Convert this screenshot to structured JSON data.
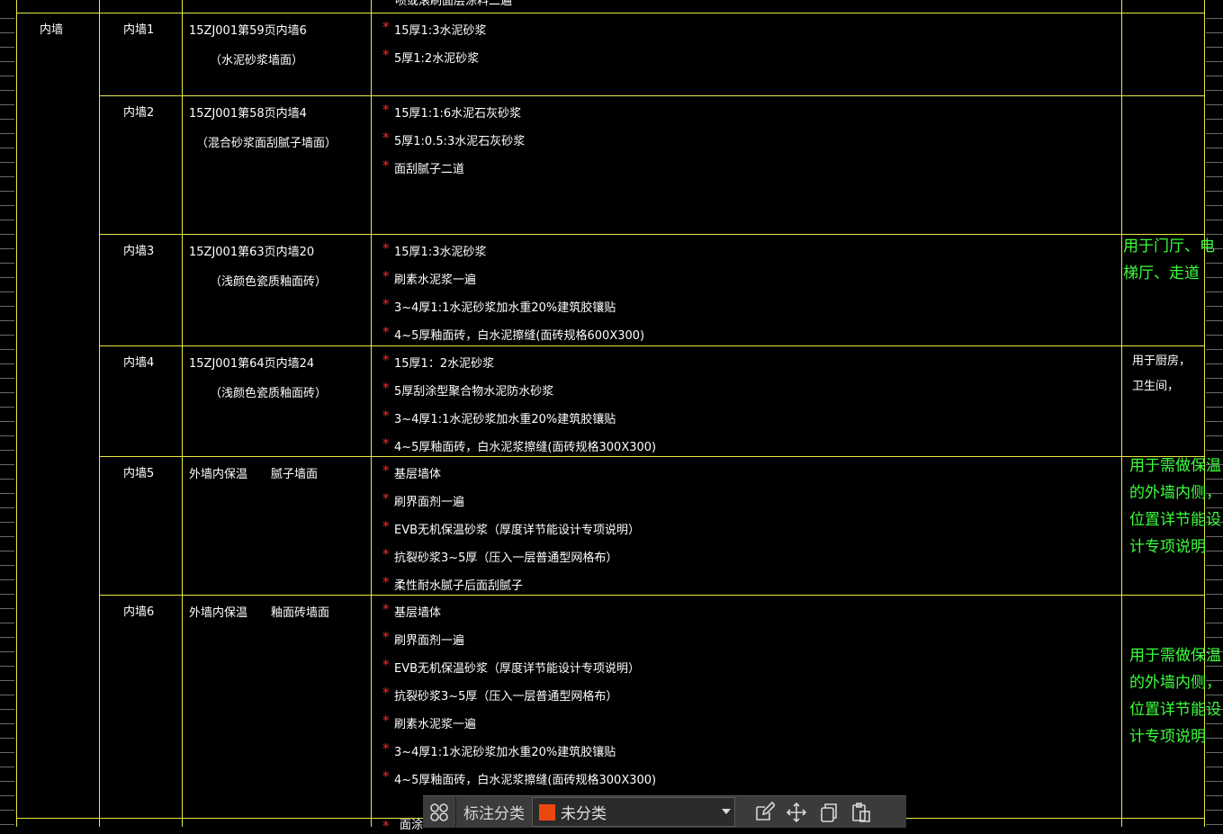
{
  "table": {
    "top_cutoff_text": "喷或滚刷面层涂料二遍",
    "group_label": "内墙",
    "rows": [
      {
        "name": "内墙1",
        "ref": "15ZJ001第59页内墙6",
        "ref_sub": "（水泥砂浆墙面）",
        "layers": [
          "15厚1:3水泥砂浆",
          "5厚1:2水泥砂浆"
        ],
        "note": ""
      },
      {
        "name": "内墙2",
        "ref": "15ZJ001第58页内墙4",
        "ref_sub": "（混合砂浆面刮腻子墙面）",
        "layers": [
          "15厚1:1:6水泥石灰砂浆",
          "5厚1:0.5:3水泥石灰砂浆",
          "面刮腻子二道"
        ],
        "note": ""
      },
      {
        "name": "内墙3",
        "ref": "15ZJ001第63页内墙20",
        "ref_sub": "（浅颜色瓷质釉面砖）",
        "layers": [
          "15厚1:3水泥砂浆",
          "刷素水泥浆一遍",
          "3~4厚1:1水泥砂浆加水重20%建筑胶镶贴",
          "4~5厚釉面砖，白水泥擦缝(面砖规格600X300)"
        ],
        "note": "用于门厅、电\n梯厅、走道"
      },
      {
        "name": "内墙4",
        "ref": "15ZJ001第64页内墙24",
        "ref_sub": "（浅颜色瓷质釉面砖）",
        "layers": [
          "15厚1：2水泥砂浆",
          "5厚刮涂型聚合物水泥防水砂浆",
          "3~4厚1:1水泥砂浆加水重20%建筑胶镶贴",
          "4~5厚釉面砖，白水泥浆擦缝(面砖规格300X300)"
        ],
        "note": "用于厨房，\n卫生间，"
      },
      {
        "name": "内墙5",
        "ref": "外墙内保温　　腻子墙面",
        "ref_sub": "",
        "layers": [
          "基层墙体",
          "刷界面剂一遍",
          "EVB无机保温砂浆（厚度详节能设计专项说明）",
          "抗裂砂浆3~5厚（压入一层普通型网格布）",
          "柔性耐水腻子后面刮腻子"
        ],
        "note": "用于需做保温\n的外墙内侧，\n位置详节能设\n计专项说明"
      },
      {
        "name": "内墙6",
        "ref": "外墙内保温　　釉面砖墙面",
        "ref_sub": "",
        "layers": [
          "基层墙体",
          "刷界面剂一遍",
          "EVB无机保温砂浆（厚度详节能设计专项说明）",
          "抗裂砂浆3~5厚（压入一层普通型网格布）",
          "刷素水泥浆一遍",
          "3~4厚1:1水泥砂浆加水重20%建筑胶镶贴",
          "4~5厚釉面砖，白水泥浆擦缝(面砖规格300X300)"
        ],
        "note": "用于需做保温\n的外墙内侧，\n位置详节能设\n计专项说明"
      }
    ],
    "bottom_cutoff_text": "面涂"
  },
  "toolbar": {
    "label": "标注分类",
    "select_value": "未分类",
    "swatch_color": "#e8490f",
    "icons": [
      "grid-icon",
      "edit-icon",
      "move-icon",
      "copy-icon",
      "paste-icon"
    ]
  },
  "colors": {
    "grid_line": "#e8e84a",
    "star": "#ff2a2a",
    "note_green": "#3cff3c",
    "background": "#000000"
  }
}
